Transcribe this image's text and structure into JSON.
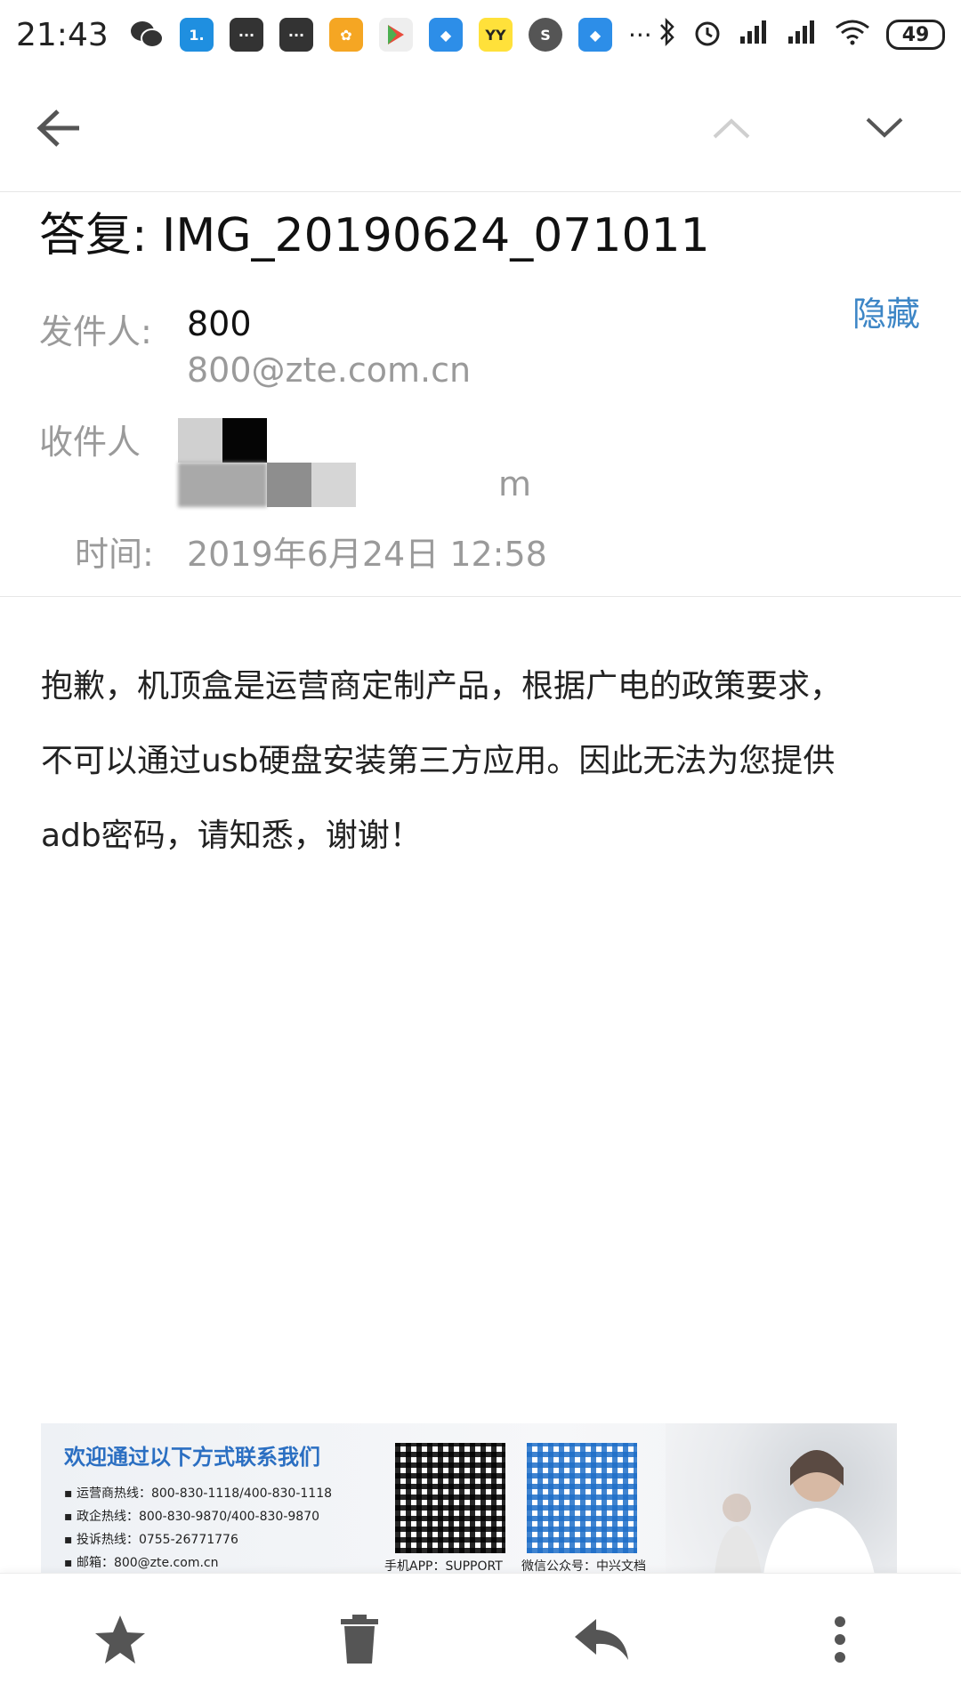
{
  "status_bar": {
    "time": "21:43",
    "battery": "49",
    "notif_icons": [
      "wechat-icon",
      "app-icon",
      "message-icon",
      "message-icon",
      "app-icon",
      "play-store-icon",
      "app-icon",
      "yy-icon",
      "app-icon",
      "app-icon"
    ],
    "yy_label": "YY"
  },
  "nav": {
    "back_icon": "back-arrow-icon",
    "prev_icon": "chevron-up-icon",
    "next_icon": "chevron-down-icon"
  },
  "email": {
    "subject": "答复: IMG_20190624_071011",
    "from_label": "发件人:",
    "from_name": "800",
    "from_address": "800@zte.com.cn",
    "hide_label": "隐藏",
    "to_label": "收件人",
    "to_address_visible_tail": "m",
    "time_label": "时间:",
    "time_value": "2019年6月24日 12:58",
    "body_lines": [
      "抱歉，机顶盒是运营商定制产品，根据广电的政策要求，",
      "不可以通过usb硬盘安装第三方应用。因此无法为您提供",
      "adb密码，请知悉，谢谢！"
    ]
  },
  "signature": {
    "title": "欢迎通过以下方式联系我们",
    "lines": [
      "▪ 运营商热线：800-830-1118/400-830-1118",
      "▪ 政企热线：800-830-9870/400-830-9870",
      "▪ 投诉热线：0755-26771776",
      "▪ 邮箱：800@zte.com.cn"
    ],
    "qr1_caption": "手机APP：SUPPORT",
    "qr2_caption": "微信公众号：中兴文档"
  },
  "bottom_bar": {
    "star_icon": "star-icon",
    "delete_icon": "trash-icon",
    "reply_icon": "reply-icon",
    "more_icon": "more-vertical-icon"
  },
  "colors": {
    "accent": "#3d86c6",
    "label_gray": "#9a9a9a",
    "icon_gray": "#555555"
  }
}
